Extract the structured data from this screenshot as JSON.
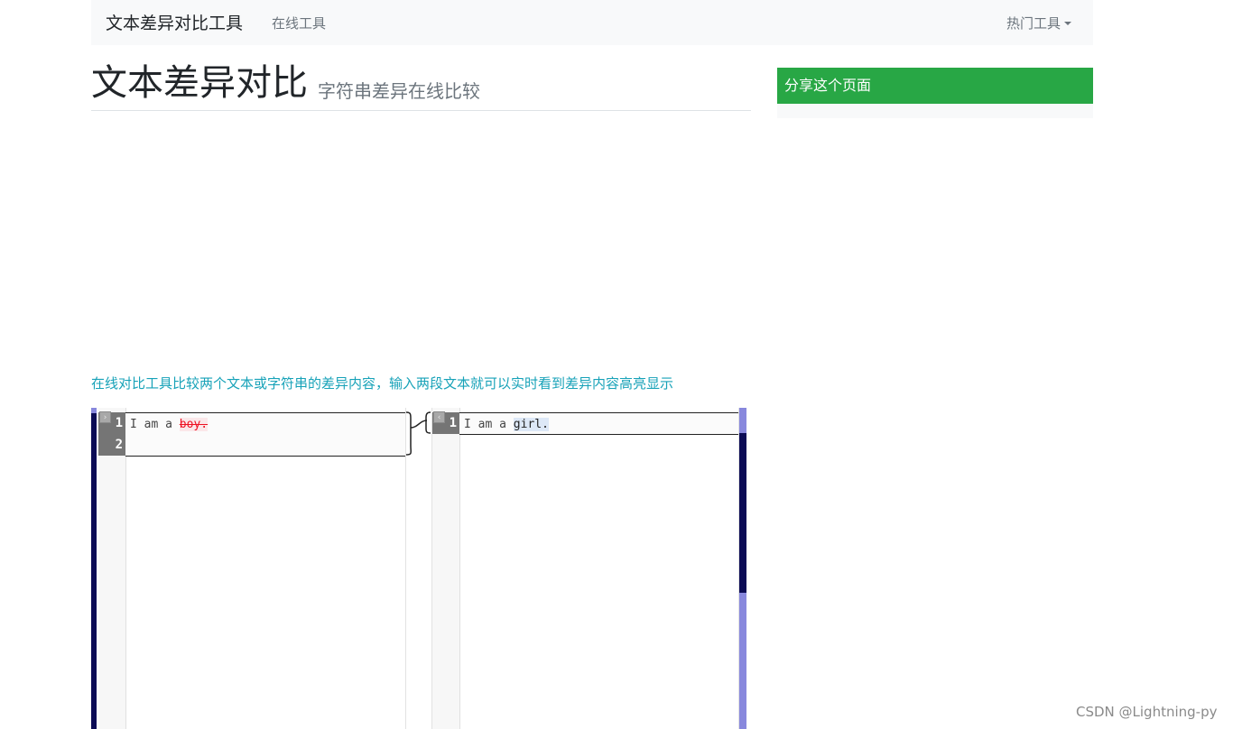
{
  "navbar": {
    "brand": "文本差异对比工具",
    "link": "在线工具",
    "dropdown": "热门工具"
  },
  "header": {
    "title": "文本差异对比",
    "subtitle": "字符串差异在线比较"
  },
  "sidebar": {
    "share_title": "分享这个页面"
  },
  "description": "在线对比工具比较两个文本或字符串的差异内容，输入两段文本就可以实时看到差异内容高亮显示",
  "editor": {
    "left": {
      "line_numbers": [
        "1",
        "2"
      ],
      "text_prefix": "I am a ",
      "text_removed": "boy."
    },
    "right": {
      "line_numbers": [
        "1"
      ],
      "text_prefix": "I am a ",
      "text_added": "girl."
    }
  },
  "watermark": "CSDN @Lightning-py",
  "colors": {
    "accent_green": "#28a745",
    "info_teal": "#17a2b8",
    "navbar_bg": "#f8f9fa",
    "deleted_red": "#ee1122",
    "scroll_dark": "#0b0b55",
    "scroll_light": "#8888dd"
  }
}
